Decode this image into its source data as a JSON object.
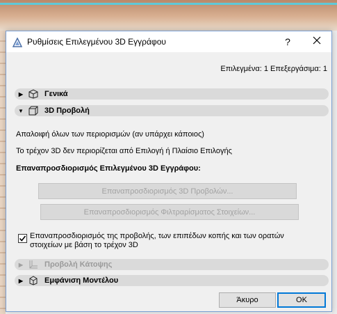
{
  "window": {
    "title": "Ρυθμίσεις Επιλεγμένου 3D Εγγράφου",
    "help_label": "?",
    "close_label": "✕"
  },
  "selection_info": "Επιλεγμένα: 1 Επεξεργάσιμα: 1",
  "panels": {
    "general": {
      "label": "Γενικά",
      "expanded": false
    },
    "view3d": {
      "label": "3D Προβολή",
      "expanded": true
    },
    "floorplan": {
      "label": "Προβολή Κάτοψης",
      "expanded": false,
      "disabled": true
    },
    "model": {
      "label": "Εμφάνιση Μοντέλου",
      "expanded": false
    }
  },
  "view3d_content": {
    "line1": "Απαλοιφή όλων των περιορισμών (αν υπάρχει κάποιος)",
    "line2": "Το τρέχον 3D δεν περιορίζεται από Επιλογή ή Πλαίσιο Επιλογής",
    "section_title": "Επαναπροσδιορισμός Επιλεγμένου 3D Εγγράφου:",
    "reset_views_button": "Επαναπροσδιορισμός 3D Προβολών...",
    "reset_filter_button": "Επαναπροσδιορισμός Φιλτραρίσματος Στοιχείων...",
    "checkbox_line1": "Επαναπροσδιορισμός της προβολής, των επιπέδων κοπής και των ορατών",
    "checkbox_line2": "στοιχείων με βάση το τρέχον 3D",
    "checkbox_checked": true
  },
  "footer": {
    "cancel_label": "Άκυρο",
    "ok_label": "OK"
  },
  "colors": {
    "dialog_border": "#7a9fd4",
    "panel_header_bg": "#dadada",
    "ok_border": "#0078d7",
    "disabled_text": "#a2a2a2"
  }
}
